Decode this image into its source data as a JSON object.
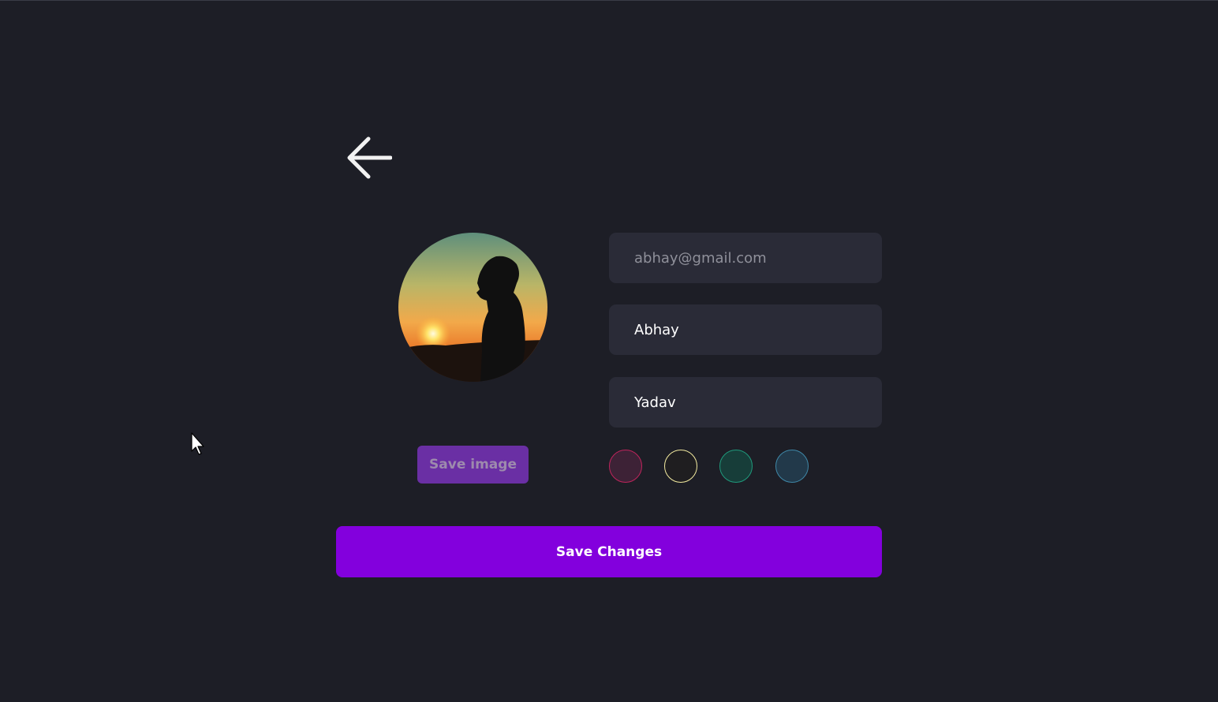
{
  "header": {
    "back_icon": "arrow-left-icon"
  },
  "profile": {
    "avatar_description_icon": "avatar-image",
    "save_image_label": "Save image"
  },
  "form": {
    "email_value": "abhay@gmail.com",
    "first_name_value": "Abhay",
    "last_name_value": "Yadav"
  },
  "theme_colors": [
    {
      "fill": "#3d2236",
      "border": "#c0245c"
    },
    {
      "fill": "#1f1e20",
      "border": "#f3eba0"
    },
    {
      "fill": "#173d39",
      "border": "#1f9a7c"
    },
    {
      "fill": "#22394a",
      "border": "#3f88a8"
    }
  ],
  "actions": {
    "save_changes_label": "Save Changes"
  },
  "colors": {
    "background": "#1d1e26",
    "field_bg": "#2a2b37",
    "accent": "#8300dd",
    "save_image_bg": "#6a2fa4"
  }
}
